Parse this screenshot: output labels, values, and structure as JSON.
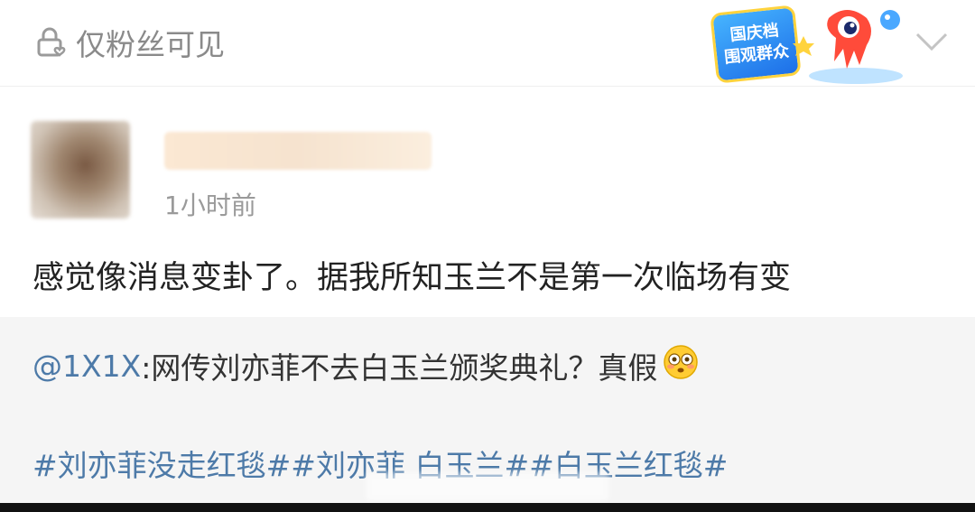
{
  "header": {
    "visibility_label": "仅粉丝可见",
    "promo_line1": "国庆档",
    "promo_line2": "围观群众"
  },
  "post": {
    "timestamp": "1小时前",
    "text": "感觉像消息变卦了。据我所知玉兰不是第一次临场有变"
  },
  "repost": {
    "mention": "@1X1X",
    "text": ":网传刘亦菲不去白玉兰颁奖典礼？真假",
    "emoji": "flushed-face-emoji",
    "hashtags": "#刘亦菲没走红毯##刘亦菲 白玉兰##白玉兰红毯#"
  },
  "colors": {
    "link": "#4d7aa8",
    "text": "#222222",
    "muted": "#9a9a9a",
    "repost_bg": "#f5f5f5"
  }
}
